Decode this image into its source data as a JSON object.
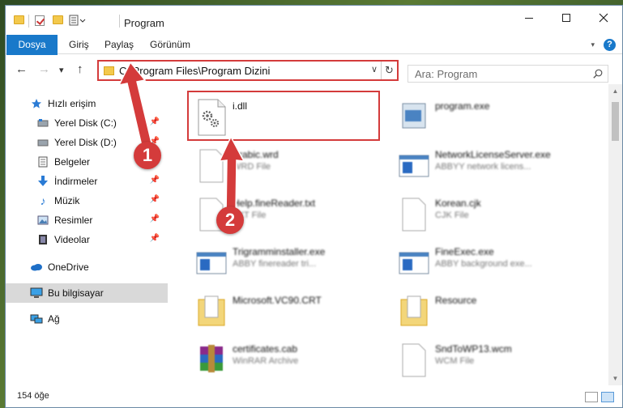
{
  "window": {
    "title": "Program"
  },
  "ribbon": {
    "tabs": [
      {
        "label": "Dosya",
        "active": true
      },
      {
        "label": "Giriş"
      },
      {
        "label": "Paylaş"
      },
      {
        "label": "Görünüm"
      }
    ],
    "help_icon": "?"
  },
  "nav": {
    "back_icon": "←",
    "forward_icon": "→",
    "recent_icon": "▾",
    "up_icon": "↑",
    "address": "C:\\Program Files\\Program Dizini",
    "refresh_icon": "↻",
    "dropdown_icon": "∨",
    "search_placeholder": "Ara: Program"
  },
  "sidebar": {
    "items": [
      {
        "label": "Hızlı erişim",
        "icon": "star-icon"
      },
      {
        "label": "Yerel Disk (C:)",
        "icon": "drive-icon",
        "pinned": true
      },
      {
        "label": "Yerel Disk (D:)",
        "icon": "drive-icon",
        "pinned": true
      },
      {
        "label": "Belgeler",
        "icon": "documents-icon",
        "pinned": true
      },
      {
        "label": "İndirmeler",
        "icon": "download-icon",
        "pinned": true
      },
      {
        "label": "Müzik",
        "icon": "music-icon",
        "pinned": true
      },
      {
        "label": "Resimler",
        "icon": "pictures-icon",
        "pinned": true
      },
      {
        "label": "Videolar",
        "icon": "videos-icon",
        "pinned": true
      },
      {
        "label": "OneDrive",
        "icon": "cloud-icon"
      },
      {
        "label": "Bu bilgisayar",
        "icon": "computer-icon",
        "active": true
      },
      {
        "label": "Ağ",
        "icon": "network-icon"
      }
    ]
  },
  "files": [
    {
      "name": "i.dll",
      "sub": "",
      "icon": "dll-gear-icon",
      "highlight": true
    },
    {
      "name": "program.exe",
      "sub": "",
      "icon": "exe-icon",
      "blur": true
    },
    {
      "name": "Arabic.wrd",
      "sub": "WRD File",
      "icon": "blank-file-icon",
      "blur": true
    },
    {
      "name": "NetworkLicenseServer.exe",
      "sub": "ABBYY network licens...",
      "icon": "window-app-icon",
      "blur": true
    },
    {
      "name": "Help.fineReader.txt",
      "sub": "TXT File",
      "icon": "blank-file-icon",
      "blur": true
    },
    {
      "name": "Korean.cjk",
      "sub": "CJK File",
      "icon": "blank-file-icon",
      "blur": true
    },
    {
      "name": "Trigramminstaller.exe",
      "sub": "ABBY finereader tri...",
      "icon": "window-app-icon",
      "blur": true
    },
    {
      "name": "FineExec.exe",
      "sub": "ABBY background exe...",
      "icon": "window-app-icon",
      "blur": true
    },
    {
      "name": "Microsoft.VC90.CRT",
      "sub": "",
      "icon": "folder-doc-icon",
      "blur": true
    },
    {
      "name": "Resource",
      "sub": "",
      "icon": "folder-doc-icon",
      "blur": true
    },
    {
      "name": "certificates.cab",
      "sub": "WinRAR Archive",
      "icon": "winrar-icon",
      "blur": true
    },
    {
      "name": "SndToWP13.wcm",
      "sub": "WCM File",
      "icon": "blank-file-icon",
      "blur": true
    }
  ],
  "status": {
    "count": "154 öğe"
  },
  "annotations": {
    "step1": "1",
    "step2": "2"
  },
  "colors": {
    "accent": "#1979ca",
    "highlight": "#d43b3b"
  }
}
